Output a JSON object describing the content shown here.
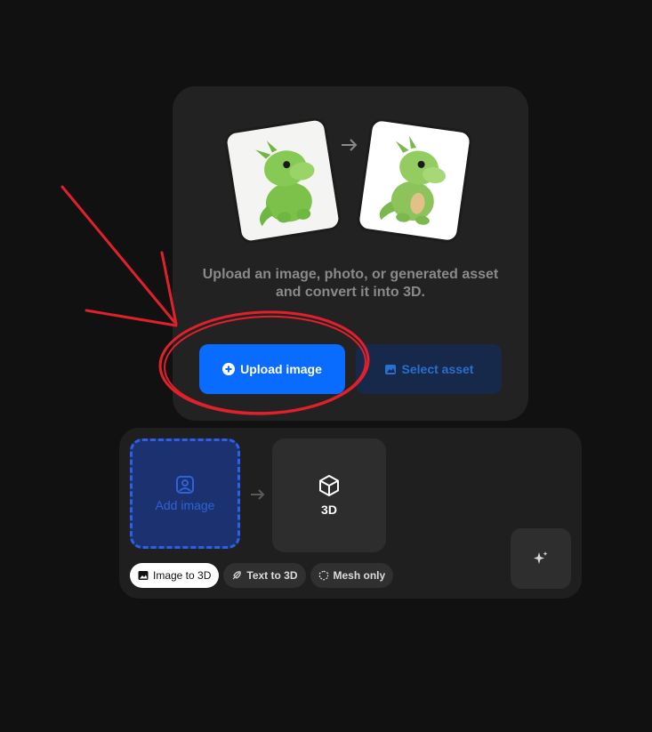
{
  "upload_card": {
    "description": "Upload an image, photo, or generated asset and convert it into 3D.",
    "upload_button": "Upload image",
    "select_button": "Select asset"
  },
  "generator": {
    "add_image": "Add image",
    "target_label": "3D",
    "modes": [
      {
        "label": "Image to 3D",
        "icon": "image-icon",
        "active": true
      },
      {
        "label": "Text to 3D",
        "icon": "feather-icon",
        "active": false
      },
      {
        "label": "Mesh only",
        "icon": "mesh-icon",
        "active": false
      }
    ]
  },
  "colors": {
    "accent": "#0a6bff",
    "annotation": "#e0202a"
  }
}
